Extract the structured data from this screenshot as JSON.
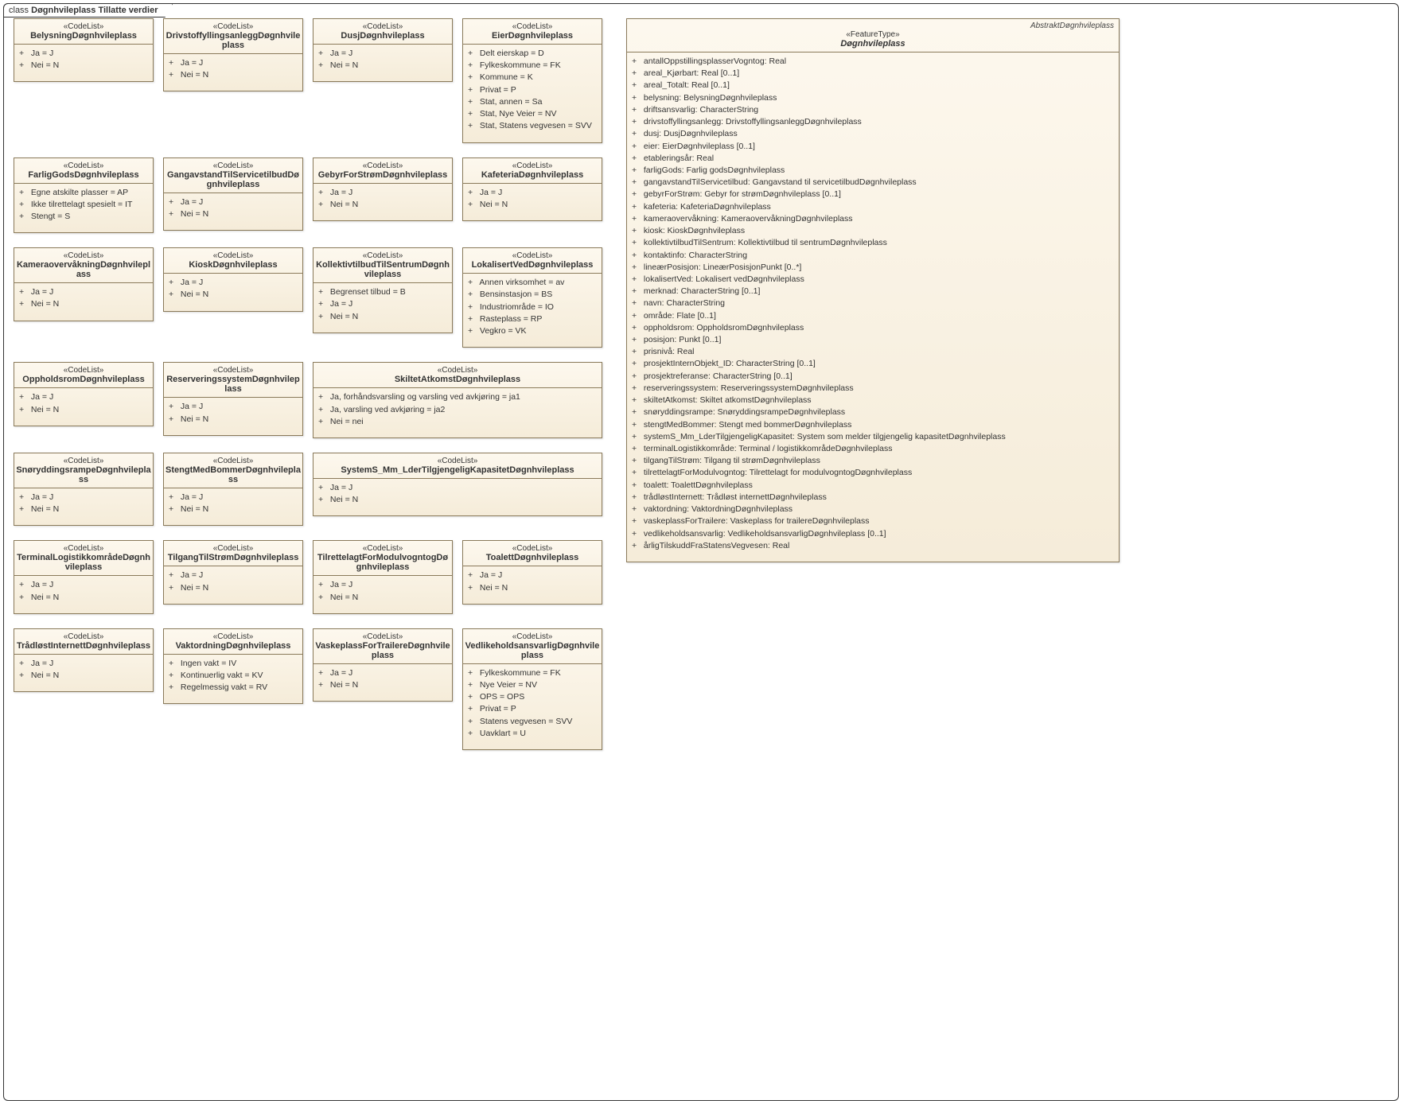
{
  "frame": {
    "prefix": "class ",
    "title": "Døgnhvileplass Tillatte verdier"
  },
  "codeListStereo": "«CodeList»",
  "featureStereo": "«FeatureType»",
  "codeLists": [
    {
      "name": "BelysningDøgnhvileplass",
      "attrs": [
        "Ja = J",
        "Nei = N"
      ]
    },
    {
      "name": "DrivstoffyllingsanleggDøgnhvileplass",
      "attrs": [
        "Ja = J",
        "Nei = N"
      ]
    },
    {
      "name": "DusjDøgnhvileplass",
      "attrs": [
        "Ja = J",
        "Nei = N"
      ]
    },
    {
      "name": "EierDøgnhvileplass",
      "attrs": [
        "Delt eierskap = D",
        "Fylkeskommune = FK",
        "Kommune = K",
        "Privat = P",
        "Stat, annen = Sa",
        "Stat, Nye Veier = NV",
        "Stat, Statens vegvesen = SVV"
      ]
    },
    {
      "name": "FarligGodsDøgnhvileplass",
      "attrs": [
        "Egne atskilte plasser = AP",
        "Ikke tilrettelagt spesielt = IT",
        "Stengt = S"
      ]
    },
    {
      "name": "GangavstandTilServicetilbudDøgnhvileplass",
      "attrs": [
        "Ja = J",
        "Nei = N"
      ]
    },
    {
      "name": "GebyrForStrømDøgnhvileplass",
      "attrs": [
        "Ja = J",
        "Nei = N"
      ]
    },
    {
      "name": "KafeteriaDøgnhvileplass",
      "attrs": [
        "Ja = J",
        "Nei = N"
      ]
    },
    {
      "name": "KameraovervåkningDøgnhvileplass",
      "attrs": [
        "Ja = J",
        "Nei = N"
      ]
    },
    {
      "name": "KioskDøgnhvileplass",
      "attrs": [
        "Ja = J",
        "Nei = N"
      ]
    },
    {
      "name": "KollektivtilbudTilSentrumDøgnhvileplass",
      "attrs": [
        "Begrenset tilbud = B",
        "Ja = J",
        "Nei = N"
      ]
    },
    {
      "name": "LokalisertVedDøgnhvileplass",
      "attrs": [
        "Annen virksomhet = av",
        "Bensinstasjon = BS",
        "Industriområde = IO",
        "Rasteplass = RP",
        "Vegkro = VK"
      ]
    },
    {
      "name": "OppholdsromDøgnhvileplass",
      "attrs": [
        "Ja = J",
        "Nei = N"
      ]
    },
    {
      "name": "ReserveringssystemDøgnhvileplass",
      "attrs": [
        "Ja = J",
        "Nei = N"
      ]
    },
    {
      "name": "SkiltetAtkomstDøgnhvileplass",
      "attrs": [
        "Ja, forhåndsvarsling og varsling ved avkjøring = ja1",
        "Ja, varsling ved avkjøring = ja2",
        "Nei = nei"
      ]
    },
    {
      "name": "SnøryddingsrampeDøgnhvileplass",
      "attrs": [
        "Ja = J",
        "Nei = N"
      ]
    },
    {
      "name": "StengtMedBommerDøgnhvileplass",
      "attrs": [
        "Ja = J",
        "Nei = N"
      ]
    },
    {
      "name": "SystemS_Mm_LderTilgjengeligKapasitetDøgnhvileplass",
      "attrs": [
        "Ja = J",
        "Nei = N"
      ]
    },
    {
      "name": "TerminalLogistikkområdeDøgnhvileplass",
      "attrs": [
        "Ja = J",
        "Nei = N"
      ]
    },
    {
      "name": "TilgangTilStrømDøgnhvileplass",
      "attrs": [
        "Ja = J",
        "Nei = N"
      ]
    },
    {
      "name": "TilrettelagtForModulvogntogDøgnhvileplass",
      "attrs": [
        "Ja = J",
        "Nei = N"
      ]
    },
    {
      "name": "ToalettDøgnhvileplass",
      "attrs": [
        "Ja = J",
        "Nei = N"
      ]
    },
    {
      "name": "TrådløstInternettDøgnhvileplass",
      "attrs": [
        "Ja = J",
        "Nei = N"
      ]
    },
    {
      "name": "VaktordningDøgnhvileplass",
      "attrs": [
        "Ingen vakt = IV",
        "Kontinuerlig vakt = KV",
        "Regelmessig vakt = RV"
      ]
    },
    {
      "name": "VaskeplassForTrailereDøgnhvileplass",
      "attrs": [
        "Ja = J",
        "Nei = N"
      ]
    },
    {
      "name": "VedlikeholdsansvarligDøgnhvileplass",
      "attrs": [
        "Fylkeskommune = FK",
        "Nye Veier = NV",
        "OPS = OPS",
        "Privat = P",
        "Statens vegvesen = SVV",
        "Uavklart = U"
      ]
    }
  ],
  "skiltetSpansTwo": true,
  "systemSpansTwo": true,
  "spacerAfterRow4": true,
  "spacerAfterRow5": true,
  "feature": {
    "abstractLabel": "AbstraktDøgnhvileplass",
    "name": "Døgnhvileplass",
    "attrs": [
      "antallOppstillingsplasserVogntog: Real",
      "areal_Kjørbart: Real [0..1]",
      "areal_Totalt: Real [0..1]",
      "belysning: BelysningDøgnhvileplass",
      "driftsansvarlig: CharacterString",
      "drivstoffyllingsanlegg: DrivstoffyllingsanleggDøgnhvileplass",
      "dusj: DusjDøgnhvileplass",
      "eier: EierDøgnhvileplass [0..1]",
      "etableringsår: Real",
      "farligGods: Farlig godsDøgnhvileplass",
      "gangavstandTilServicetilbud: Gangavstand til servicetilbudDøgnhvileplass",
      "gebyrForStrøm: Gebyr for strømDøgnhvileplass [0..1]",
      "kafeteria: KafeteriaDøgnhvileplass",
      "kameraovervåkning: KameraovervåkningDøgnhvileplass",
      "kiosk: KioskDøgnhvileplass",
      "kollektivtilbudTilSentrum: Kollektivtilbud til sentrumDøgnhvileplass",
      "kontaktinfo: CharacterString",
      "lineærPosisjon: LineærPosisjonPunkt [0..*]",
      "lokalisertVed: Lokalisert vedDøgnhvileplass",
      "merknad: CharacterString [0..1]",
      "navn: CharacterString",
      "område: Flate [0..1]",
      "oppholdsrom: OppholdsromDøgnhvileplass",
      "posisjon: Punkt [0..1]",
      "prisnivå: Real",
      "prosjektInternObjekt_ID: CharacterString [0..1]",
      "prosjektreferanse: CharacterString [0..1]",
      "reserveringssystem: ReserveringssystemDøgnhvileplass",
      "skiltetAtkomst: Skiltet atkomstDøgnhvileplass",
      "snøryddingsrampe: SnøryddingsrampeDøgnhvileplass",
      "stengtMedBommer: Stengt med bommerDøgnhvileplass",
      "systemS_Mm_LderTilgjengeligKapasitet: System som melder tilgjengelig kapasitetDøgnhvileplass",
      "terminalLogistikkområde: Terminal / logistikkområdeDøgnhvileplass",
      "tilgangTilStrøm: Tilgang til strømDøgnhvileplass",
      "tilrettelagtForModulvogntog: Tilrettelagt for modulvogntogDøgnhvileplass",
      "toalett: ToalettDøgnhvileplass",
      "trådløstInternett: Trådløst internettDøgnhvileplass",
      "vaktordning: VaktordningDøgnhvileplass",
      "vaskeplassForTrailere: Vaskeplass for trailereDøgnhvileplass",
      "vedlikeholdsansvarlig: VedlikeholdsansvarligDøgnhvileplass [0..1]",
      "årligTilskuddFraStatensVegvesen: Real"
    ]
  }
}
